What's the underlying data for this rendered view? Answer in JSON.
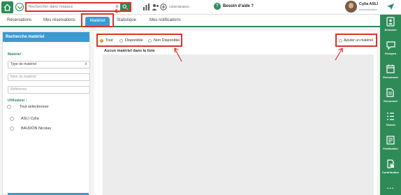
{
  "topbar": {
    "search_placeholder": "Rechercher dans l'espace",
    "admin_label": "Administrateur",
    "help_label": "Besoin d'aide ?",
    "user_name": "Cylia ASLI",
    "user_role": "Administrateur"
  },
  "tabs": [
    {
      "label": "Réservations"
    },
    {
      "label": "Mes réservations"
    },
    {
      "label": "Matériel"
    },
    {
      "label": "Statistique"
    },
    {
      "label": "Mes notifications"
    }
  ],
  "filter_panel": {
    "title": "Recherche matériel",
    "material_label": "Matériel :",
    "type_select_value": "Type de matériel",
    "name_placeholder": "Nom du matériel",
    "reference_placeholder": "Référence",
    "user_label": "Utilisateur :",
    "select_all": "Tout selectionner",
    "users": [
      "ASLI Cylia",
      "BAUDON Nicolas"
    ]
  },
  "main": {
    "radios": [
      {
        "label": "Tout",
        "selected": true
      },
      {
        "label": "Disponible",
        "selected": false
      },
      {
        "label": "Non Disponible",
        "selected": false
      }
    ],
    "add_label": "Ajouter un matériel",
    "empty_message": "Aucun matériel dans la liste"
  },
  "sidebar": [
    {
      "label": "Annuaire",
      "icon": "contact-book-icon"
    },
    {
      "label": "Groupes",
      "icon": "chat-bubble-icon"
    },
    {
      "label": "Evènement",
      "icon": "calendar-icon"
    },
    {
      "label": "Document",
      "icon": "document-icon"
    },
    {
      "label": "Tâches",
      "icon": "task-list-icon"
    },
    {
      "label": "Publication",
      "icon": "publication-icon"
    },
    {
      "label": "Contribution",
      "icon": "contribution-icon"
    }
  ],
  "sidebar_more": "...",
  "colors": {
    "green": "#2e8b57",
    "blue": "#3b9ad1",
    "highlight_red": "#d9322a",
    "radio_orange": "#f2a22c"
  }
}
